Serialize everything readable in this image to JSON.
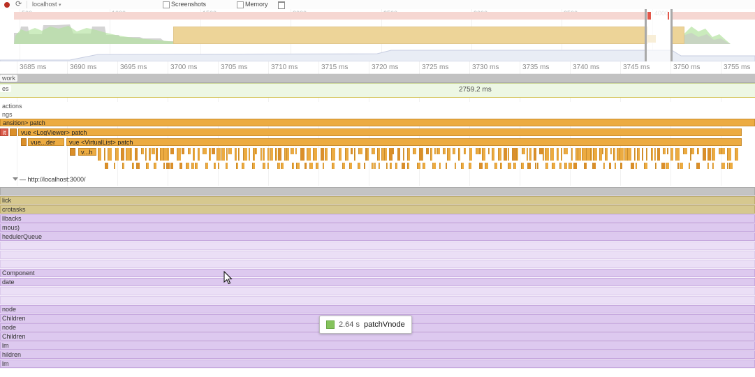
{
  "colors": {
    "flame_orange": "#ecab41",
    "flame_orange_dark": "#db8f2a",
    "flame_red": "#d95b4a",
    "call_khaki": "#d6c88f",
    "call_lavender": "#ddc9ef",
    "task_gray": "#c4c4c4",
    "frames_green": "#edf7e4",
    "cpu_yellow": "#e3bd62",
    "tooltip_swatch_green": "#85c35c"
  },
  "toolbar": {
    "target_label": "localhost",
    "screenshots_label": "Screenshots",
    "memory_label": "Memory"
  },
  "overview": {
    "ticks": [
      "500 ms",
      "1000 ms",
      "1500 ms",
      "2000 ms",
      "2500 ms",
      "3000 ms",
      "3500 ms",
      "4000 ms"
    ]
  },
  "detail_ruler": {
    "ticks": [
      "3685 ms",
      "3690 ms",
      "3695 ms",
      "3700 ms",
      "3705 ms",
      "3710 ms",
      "3715 ms",
      "3720 ms",
      "3725 ms",
      "3730 ms",
      "3735 ms",
      "3740 ms",
      "3745 ms",
      "3750 ms",
      "3755 ms"
    ]
  },
  "tracks": {
    "network": {
      "label": "work"
    },
    "frames": {
      "label": "es",
      "duration_badge": "2759.2 ms"
    },
    "interactions": {
      "label": "actions"
    },
    "timings": {
      "label": "ngs",
      "bars": {
        "row0": "ansition> patch",
        "row1_left": "it",
        "row1": "vue <LogViewer> patch",
        "row2_left": "vue...der",
        "row2": "vue <VirtualList> patch",
        "row3_left": "v...h"
      }
    },
    "main": {
      "header": "— http://localhost:3000/",
      "rows": [
        {
          "label": "",
          "kind": "gray"
        },
        {
          "label": "lick",
          "kind": "khaki"
        },
        {
          "label": "crotasks",
          "kind": "khaki"
        },
        {
          "label": "llbacks",
          "kind": "lav"
        },
        {
          "label": "mous)",
          "kind": "lav"
        },
        {
          "label": "hedulerQueue",
          "kind": "lav"
        },
        {
          "label": "",
          "kind": "lavlight"
        },
        {
          "label": "",
          "kind": "lavlight"
        },
        {
          "label": "",
          "kind": "lavlight"
        },
        {
          "label": "Component",
          "kind": "lav"
        },
        {
          "label": "date",
          "kind": "lav"
        },
        {
          "label": "",
          "kind": "lavlight"
        },
        {
          "label": "",
          "kind": "lavlight"
        },
        {
          "label": "node",
          "kind": "lav"
        },
        {
          "label": "Children",
          "kind": "lav"
        },
        {
          "label": "node",
          "kind": "lav"
        },
        {
          "label": "Children",
          "kind": "lav"
        },
        {
          "label": "lm",
          "kind": "lav"
        },
        {
          "label": "hildren",
          "kind": "lav"
        },
        {
          "label": "lm",
          "kind": "lav"
        }
      ]
    }
  },
  "tooltip": {
    "duration": "2.64 s",
    "function_name": "patchVnode"
  }
}
